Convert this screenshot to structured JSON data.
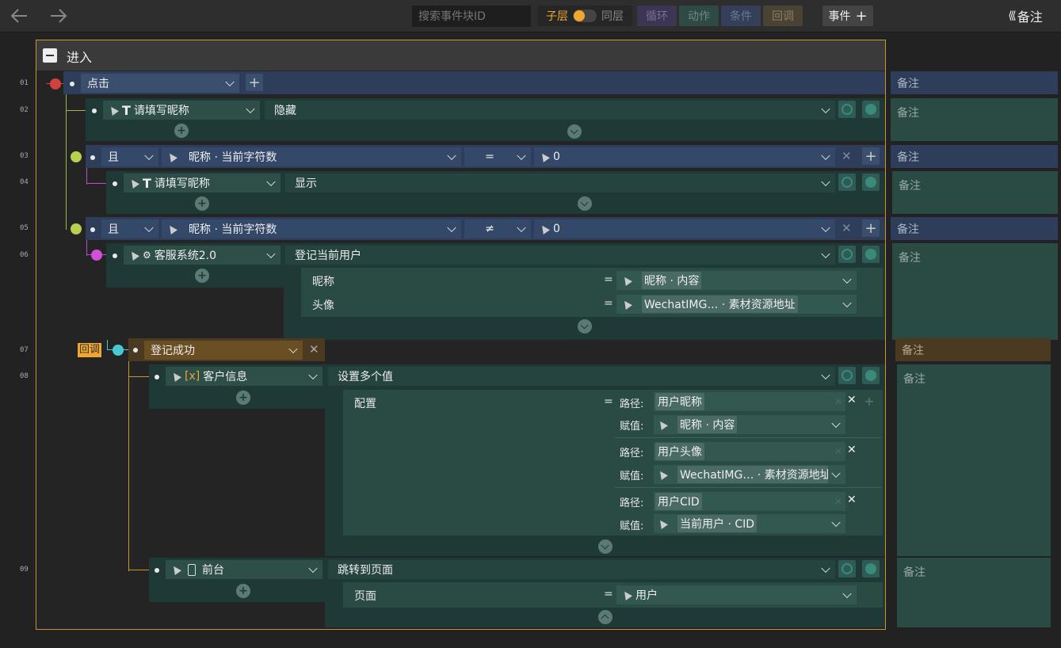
{
  "toolbar": {
    "search_placeholder": "搜索事件块ID",
    "toggle_left": "子层",
    "toggle_right": "同层",
    "tag_loop": "循环",
    "tag_action": "动作",
    "tag_condition": "条件",
    "tag_callback": "回调",
    "event_button": "事件",
    "notes_button": "备注"
  },
  "block": {
    "title": "进入"
  },
  "rows": {
    "r01": {
      "num": "01",
      "event": "点击"
    },
    "r02": {
      "num": "02",
      "target": "请填写昵称",
      "action": "隐藏"
    },
    "r03": {
      "num": "03",
      "logic": "且",
      "left": "昵称 · 当前字符数",
      "op": "=",
      "right": "0"
    },
    "r04": {
      "num": "04",
      "target": "请填写昵称",
      "action": "显示"
    },
    "r05": {
      "num": "05",
      "logic": "且",
      "left": "昵称 · 当前字符数",
      "op": "≠",
      "right": "0"
    },
    "r06": {
      "num": "06",
      "target": "客服系统2.0",
      "action": "登记当前用户",
      "p1_label": "昵称",
      "p1_value": "昵称 · 内容",
      "p2_label": "头像",
      "p2_value": "WechatIMG… · 素材资源地址"
    },
    "r07": {
      "num": "07",
      "callback_tag": "回调",
      "callback": "登记成功"
    },
    "r08": {
      "num": "08",
      "target": "客户信息",
      "target_icon": "[x]",
      "action": "设置多个值",
      "config_label": "配置",
      "path_label": "路径:",
      "assign_label": "赋值:",
      "items": [
        {
          "path": "用户昵称",
          "value": "昵称 · 内容"
        },
        {
          "path": "用户头像",
          "value": "WechatIMG… · 素材资源地址"
        },
        {
          "path": "用户CID",
          "value": "当前用户 · CID"
        }
      ]
    },
    "r09": {
      "num": "09",
      "target": "前台",
      "action": "跳转到页面",
      "p1_label": "页面",
      "p1_value": "用户"
    }
  },
  "notes": {
    "label": "备注"
  },
  "eq": "="
}
